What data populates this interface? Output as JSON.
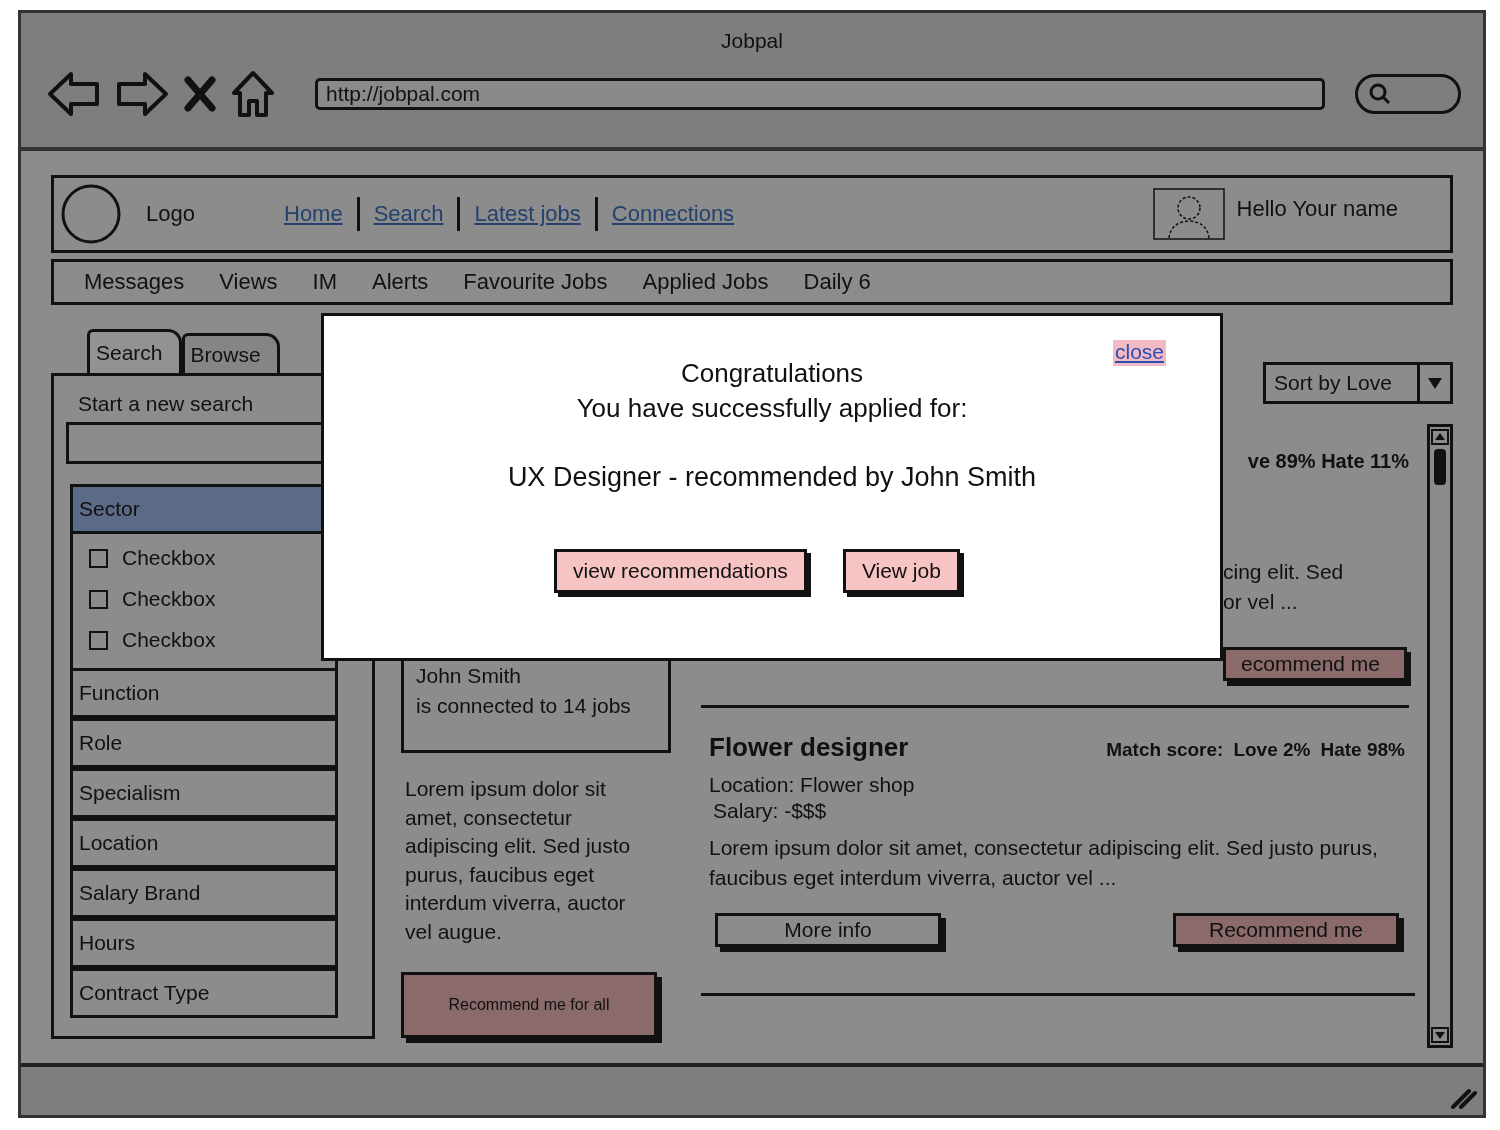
{
  "window": {
    "title": "Jobpal"
  },
  "browser": {
    "url": "http://jobpal.com"
  },
  "header": {
    "logo": "Logo",
    "links": [
      "Home",
      "Search",
      "Latest jobs",
      "Connections"
    ],
    "greeting": "Hello Your name"
  },
  "nav": [
    "Messages",
    "Views",
    "IM",
    "Alerts",
    "Favourite Jobs",
    "Applied Jobs",
    "Daily 6"
  ],
  "sidebar": {
    "tabs": [
      {
        "label": "Search",
        "selected": true
      },
      {
        "label": "Browse",
        "selected": false
      }
    ],
    "search_label": "Start a new search",
    "filters": [
      {
        "label": "Sector",
        "expanded": true,
        "options": [
          {
            "label": "Checkbox",
            "checked": false
          },
          {
            "label": "Checkbox",
            "checked": false
          },
          {
            "label": "Checkbox",
            "checked": false
          }
        ]
      },
      {
        "label": "Function",
        "expanded": false
      },
      {
        "label": "Role",
        "expanded": false
      },
      {
        "label": "Specialism",
        "expanded": false
      },
      {
        "label": "Location",
        "expanded": false
      },
      {
        "label": "Salary Brand",
        "expanded": false
      },
      {
        "label": "Hours",
        "expanded": false
      },
      {
        "label": "Contract Type",
        "expanded": false
      }
    ]
  },
  "connection": {
    "name": "John Smith",
    "text": "is connected to 14 jobs"
  },
  "summary": "Lorem ipsum dolor sit amet, consectetur adipiscing elit. Sed justo purus, faucibus eget interdum viverra, auctor vel augue.",
  "recommend_all": "Recommend me for all",
  "sort": {
    "value": "Sort by Love"
  },
  "jobs": [
    {
      "kind": "cut",
      "match": "ve 89%  Hate 11%",
      "description_lines": [
        "cing elit. Sed",
        "or vel ..."
      ],
      "recommend": "ecommend me"
    },
    {
      "kind": "full",
      "title": "Flower designer",
      "match_label": "Match score:",
      "love": "Love 2%",
      "hate": "Hate 98%",
      "location": "Location: Flower shop",
      "salary": "Salary: -$$$",
      "description": "Lorem ipsum dolor sit amet, consectetur adipiscing elit. Sed justo purus, faucibus eget interdum viverra, auctor vel ...",
      "more": "More info",
      "recommend": "Recommend me"
    }
  ],
  "dialog": {
    "close": "close",
    "lines": [
      "Congratulations",
      "You have successfully applied for:"
    ],
    "job": "UX Designer - recommended by John Smith",
    "buttons": [
      "view recommendations",
      "View job"
    ]
  }
}
